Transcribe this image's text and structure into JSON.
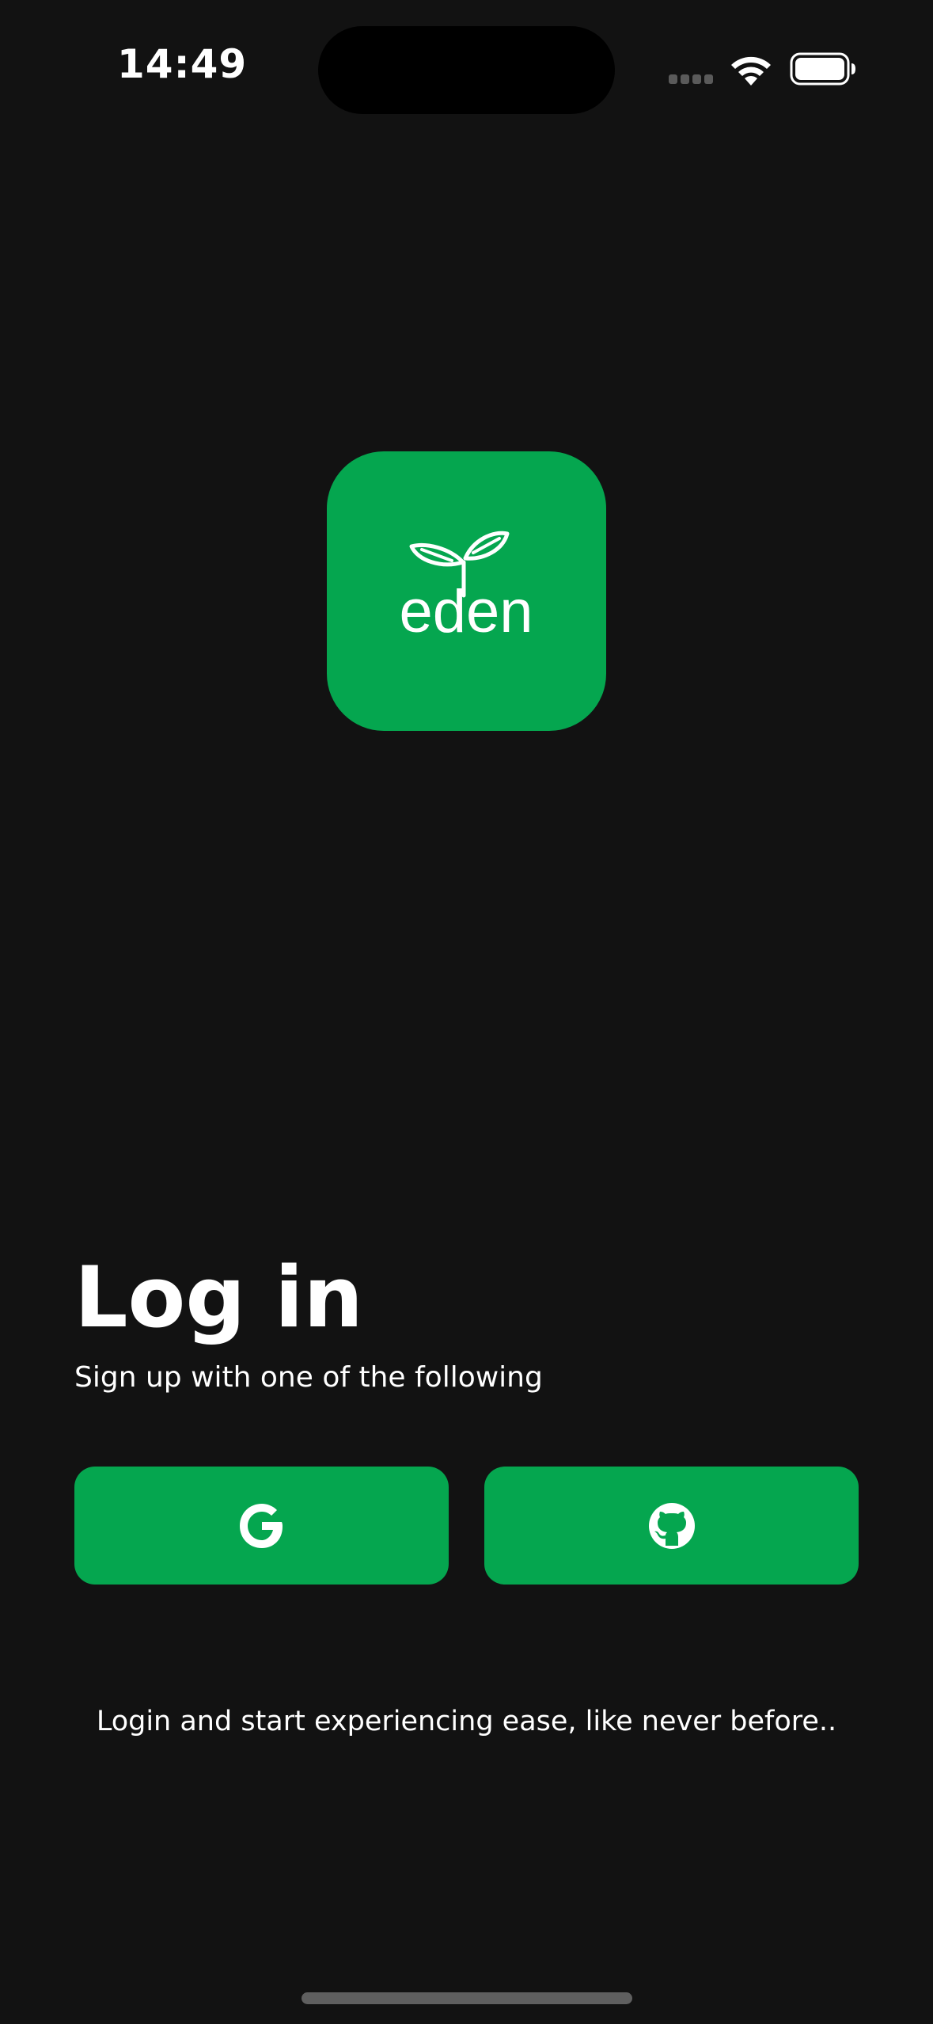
{
  "status_bar": {
    "time": "14:49",
    "icons": [
      "signal-icon",
      "wifi-icon",
      "battery-icon"
    ]
  },
  "logo": {
    "wordmark": "eden",
    "icon": "sprout-icon"
  },
  "login": {
    "title": "Log in",
    "subtitle": "Sign up with one of the following"
  },
  "providers": [
    {
      "name": "Google",
      "icon": "google-icon"
    },
    {
      "name": "GitHub",
      "icon": "github-icon"
    }
  ],
  "tagline": "Login and start experiencing ease, like never before..",
  "colors": {
    "background": "#121212",
    "accent": "#05a64f",
    "text": "#ffffff"
  }
}
